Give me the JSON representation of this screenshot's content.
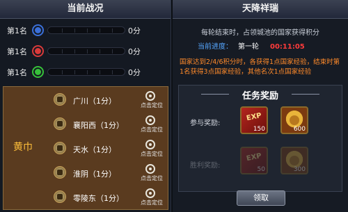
{
  "left": {
    "title": "当前战况",
    "ranking": [
      {
        "label": "第1名",
        "points": "0分",
        "color": "#3a6fd8"
      },
      {
        "label": "第1名",
        "points": "0分",
        "color": "#d83a3a"
      },
      {
        "label": "第1名",
        "points": "0分",
        "color": "#37c03a"
      }
    ],
    "faction": "黄巾",
    "locate_label": "点击定位",
    "cities": [
      {
        "name": "广川（1分）"
      },
      {
        "name": "襄阳西（1分）"
      },
      {
        "name": "天水（1分）"
      },
      {
        "name": "淮阴（1分）"
      },
      {
        "name": "零陵东（1分）"
      }
    ]
  },
  "right": {
    "title": "天降祥瑞",
    "description": "每轮结束时，占领城池的国家获得积分",
    "progress": {
      "label": "当前进度：",
      "round": "第一轮",
      "timer": "00:11:05"
    },
    "rule": "国家达到2/4/6积分时，各获得1点国家经验，结束时第1名获得3点国家经验，其他名次1点国家经验",
    "rewards": {
      "title": "任务奖励",
      "participation_label": "参与奖励:",
      "victory_label": "胜利奖励:",
      "participation_items": [
        {
          "icon": "exp-icon",
          "tag": "EXP",
          "count": "150"
        },
        {
          "icon": "coin-icon",
          "count": "600"
        }
      ],
      "victory_items": [
        {
          "icon": "exp-icon",
          "tag": "EXP",
          "count": "50"
        },
        {
          "icon": "coin-icon",
          "count": "300"
        }
      ]
    },
    "claim_button": "领取"
  }
}
